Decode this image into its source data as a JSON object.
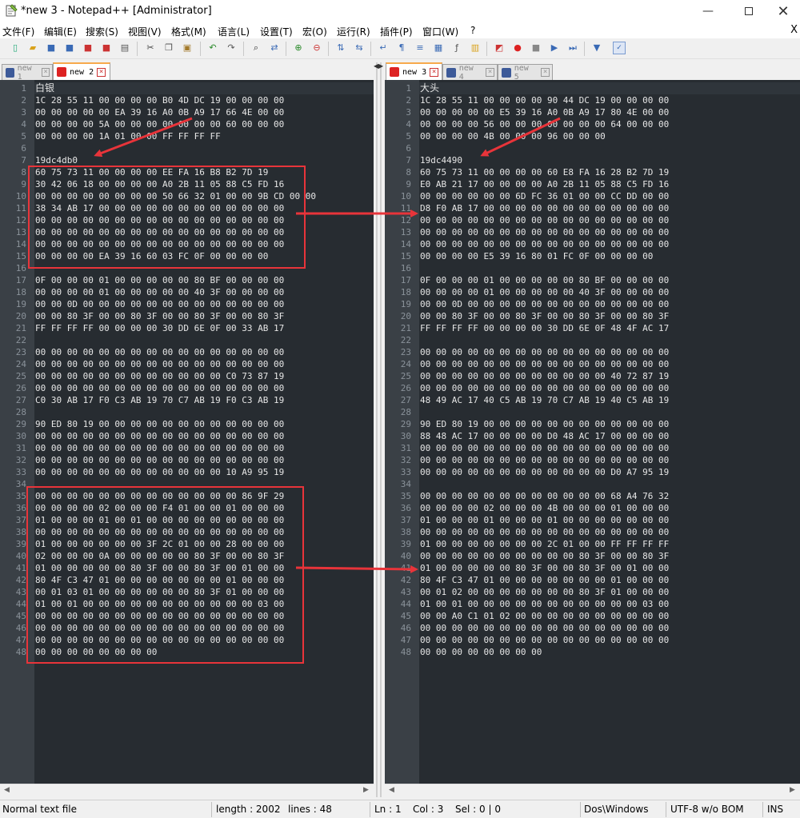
{
  "window": {
    "title": "*new 3 - Notepad++ [Administrator]"
  },
  "menu": [
    "文件(F)",
    "编辑(E)",
    "搜索(S)",
    "视图(V)",
    "格式(M)",
    "语言(L)",
    "设置(T)",
    "宏(O)",
    "运行(R)",
    "插件(P)",
    "窗口(W)",
    "?"
  ],
  "menu_close": "X",
  "toolbar_icons": [
    "new-file-icon",
    "open-file-icon",
    "save-icon",
    "save-all-icon",
    "close-icon",
    "close-all-icon",
    "print-icon",
    "cut-icon",
    "copy-icon",
    "paste-icon",
    "undo-icon",
    "redo-icon",
    "find-icon",
    "replace-icon",
    "zoom-in-icon",
    "zoom-out-icon",
    "sync-vertical-icon",
    "sync-horizontal-icon",
    "word-wrap-icon",
    "show-all-chars-icon",
    "indent-guide-icon",
    "doc-map-icon",
    "function-list-icon",
    "folder-workspace-icon",
    "monitor-icon",
    "record-macro-icon",
    "stop-macro-icon",
    "play-macro-icon",
    "run-macro-multiple-icon",
    "save-macro-icon",
    "spell-check-icon",
    "settings-icon"
  ],
  "left_tabs": [
    {
      "label": "new 1",
      "active": false
    },
    {
      "label": "new 2",
      "active": true
    }
  ],
  "right_tabs": [
    {
      "label": "new 3",
      "active": true
    },
    {
      "label": "new 4",
      "active": false
    },
    {
      "label": "new 5",
      "active": false
    }
  ],
  "left_lines": [
    "白银",
    "1C 28 55 11 00 00 00 00 B0 4D DC 19 00 00 00 00",
    "00 00 00 00 00 EA 39 16 A0 0B A9 17 66 4E 00 00",
    "00 00 00 00 5A 00 00 00 00 00 00 00 60 00 00 00",
    "00 00 00 00 1A 01 00 00 FF FF FF FF",
    "",
    "19dc4db0",
    "60 75 73 11 00 00 00 00 EE FA 16 B8 B2 7D 19",
    "30 42 06 18 00 00 00 00 A0 2B 11 05 88 C5 FD 16",
    "00 00 00 00 00 00 00 00 50 66 32 01 00 00 9B CD 00 00",
    "38 34 AB 17 00 00 00 00 00 00 00 00 00 00 00 00",
    "00 00 00 00 00 00 00 00 00 00 00 00 00 00 00 00",
    "00 00 00 00 00 00 00 00 00 00 00 00 00 00 00 00",
    "00 00 00 00 00 00 00 00 00 00 00 00 00 00 00 00",
    "00 00 00 00 EA 39 16 60 03 FC 0F 00 00 00 00",
    "",
    "0F 00 00 00 01 00 00 00 00 00 80 BF 00 00 00 00",
    "00 00 00 00 01 00 00 00 00 00 40 3F 00 00 00 00",
    "00 00 0D 00 00 00 00 00 00 00 00 00 00 00 00 00",
    "00 00 80 3F 00 00 80 3F 00 00 80 3F 00 00 80 3F",
    "FF FF FF FF 00 00 00 00 30 DD 6E 0F 00 33 AB 17",
    "",
    "00 00 00 00 00 00 00 00 00 00 00 00 00 00 00 00",
    "00 00 00 00 00 00 00 00 00 00 00 00 00 00 00 00",
    "00 00 00 00 00 00 00 00 00 00 00 00 C0 73 87 19",
    "00 00 00 00 00 00 00 00 00 00 00 00 00 00 00 00",
    "C0 30 AB 17 F0 C3 AB 19 70 C7 AB 19 F0 C3 AB 19",
    "",
    "90 ED 80 19 00 00 00 00 00 00 00 00 00 00 00 00",
    "00 00 00 00 00 00 00 00 00 00 00 00 00 00 00 00",
    "00 00 00 00 00 00 00 00 00 00 00 00 00 00 00 00",
    "00 00 00 00 00 00 00 00 00 00 00 00 00 00 00 00",
    "00 00 00 00 00 00 00 00 00 00 00 00 10 A9 95 19",
    "",
    "00 00 00 00 00 00 00 00 00 00 00 00 00 86 9F 29",
    "00 00 00 00 02 00 00 00 F4 01 00 00 01 00 00 00",
    "01 00 00 00 01 00 01 00 00 00 00 00 00 00 00 00",
    "00 00 00 00 00 00 00 00 00 00 00 00 00 00 00 00",
    "01 00 00 00 00 00 00 3F 2C 01 00 00 28 00 00 00",
    "02 00 00 00 0A 00 00 00 00 00 80 3F 00 00 80 3F",
    "01 00 00 00 00 00 80 3F 00 00 80 3F 00 01 00 00",
    "80 4F C3 47 01 00 00 00 00 00 00 00 01 00 00 00",
    "00 01 03 01 00 00 00 00 00 00 80 3F 01 00 00 00",
    "01 00 01 00 00 00 00 00 00 00 00 00 00 00 03 00",
    "00 00 00 00 00 00 00 00 00 00 00 00 00 00 00 00",
    "00 00 00 00 00 00 00 00 00 00 00 00 00 00 00 00",
    "00 00 00 00 00 00 00 00 00 00 00 00 00 00 00 00",
    "00 00 00 00 00 00 00 00"
  ],
  "right_lines": [
    "大头",
    "1C 28 55 11 00 00 00 00 90 44 DC 19 00 00 00 00",
    "00 00 00 00 00 E5 39 16 A0 0B A9 17 80 4E 00 00",
    "00 00 00 00 56 00 00 00 00 00 00 00 64 00 00 00",
    "00 00 00 00 4B 00 00 00 96 00 00 00",
    "",
    "19dc4490",
    "60 75 73 11 00 00 00 00 60 E8 FA 16 28 B2 7D 19",
    "E0 AB 21 17 00 00 00 00 A0 2B 11 05 88 C5 FD 16",
    "00 00 00 00 00 00 6D FC 36 01 00 00 CC DD 00 00",
    "D8 F0 AB 17 00 00 00 00 00 00 00 00 00 00 00 00",
    "00 00 00 00 00 00 00 00 00 00 00 00 00 00 00 00",
    "00 00 00 00 00 00 00 00 00 00 00 00 00 00 00 00",
    "00 00 00 00 00 00 00 00 00 00 00 00 00 00 00 00",
    "00 00 00 00 E5 39 16 80 01 FC 0F 00 00 00 00",
    "",
    "0F 00 00 00 01 00 00 00 00 00 80 BF 00 00 00 00",
    "00 00 00 00 01 00 00 00 00 00 40 3F 00 00 00 00",
    "00 00 0D 00 00 00 00 00 00 00 00 00 00 00 00 00",
    "00 00 80 3F 00 00 80 3F 00 00 80 3F 00 00 80 3F",
    "FF FF FF FF 00 00 00 00 30 DD 6E 0F 48 4F AC 17",
    "",
    "00 00 00 00 00 00 00 00 00 00 00 00 00 00 00 00",
    "00 00 00 00 00 00 00 00 00 00 00 00 00 00 00 00",
    "00 00 00 00 00 00 00 00 00 00 00 00 40 72 87 19",
    "00 00 00 00 00 00 00 00 00 00 00 00 00 00 00 00",
    "48 49 AC 17 40 C5 AB 19 70 C7 AB 19 40 C5 AB 19",
    "",
    "90 ED 80 19 00 00 00 00 00 00 00 00 00 00 00 00",
    "88 48 AC 17 00 00 00 00 D0 48 AC 17 00 00 00 00",
    "00 00 00 00 00 00 00 00 00 00 00 00 00 00 00 00",
    "00 00 00 00 00 00 00 00 00 00 00 00 00 00 00 00",
    "00 00 00 00 00 00 00 00 00 00 00 00 D0 A7 95 19",
    "",
    "00 00 00 00 00 00 00 00 00 00 00 00 68 A4 76 32",
    "00 00 00 00 02 00 00 00 4B 00 00 00 01 00 00 00",
    "01 00 00 00 01 00 00 00 01 00 00 00 00 00 00 00",
    "00 00 00 00 00 00 00 00 00 00 00 00 00 00 00 00",
    "01 00 00 00 00 00 00 00 2C 01 00 00 FF FF FF FF",
    "00 00 00 00 00 00 00 00 00 00 80 3F 00 00 80 3F",
    "01 00 00 00 00 00 80 3F 00 00 80 3F 00 01 00 00",
    "80 4F C3 47 01 00 00 00 00 00 00 00 01 00 00 00",
    "00 01 02 00 00 00 00 00 00 00 80 3F 01 00 00 00",
    "01 00 01 00 00 00 00 00 00 00 00 00 00 00 03 00",
    "00 00 A0 C1 01 02 00 00 00 00 00 00 00 00 00 00",
    "00 00 00 00 00 00 00 00 00 00 00 00 00 00 00 00",
    "00 00 00 00 00 00 00 00 00 00 00 00 00 00 00 00",
    "00 00 00 00 00 00 00 00"
  ],
  "status": {
    "filetype": "Normal text file",
    "length": "length : 2002",
    "lines": "lines : 48",
    "ln": "Ln : 1",
    "col": "Col : 3",
    "sel": "Sel : 0 | 0",
    "eol": "Dos\\Windows",
    "encoding": "UTF-8 w/o BOM",
    "mode": "INS"
  },
  "colors": {
    "editor_bg": "#272c31",
    "gutter_bg": "#3a4046",
    "annotation": "#e8343a",
    "active_tab_accent": "#f7a94c"
  }
}
